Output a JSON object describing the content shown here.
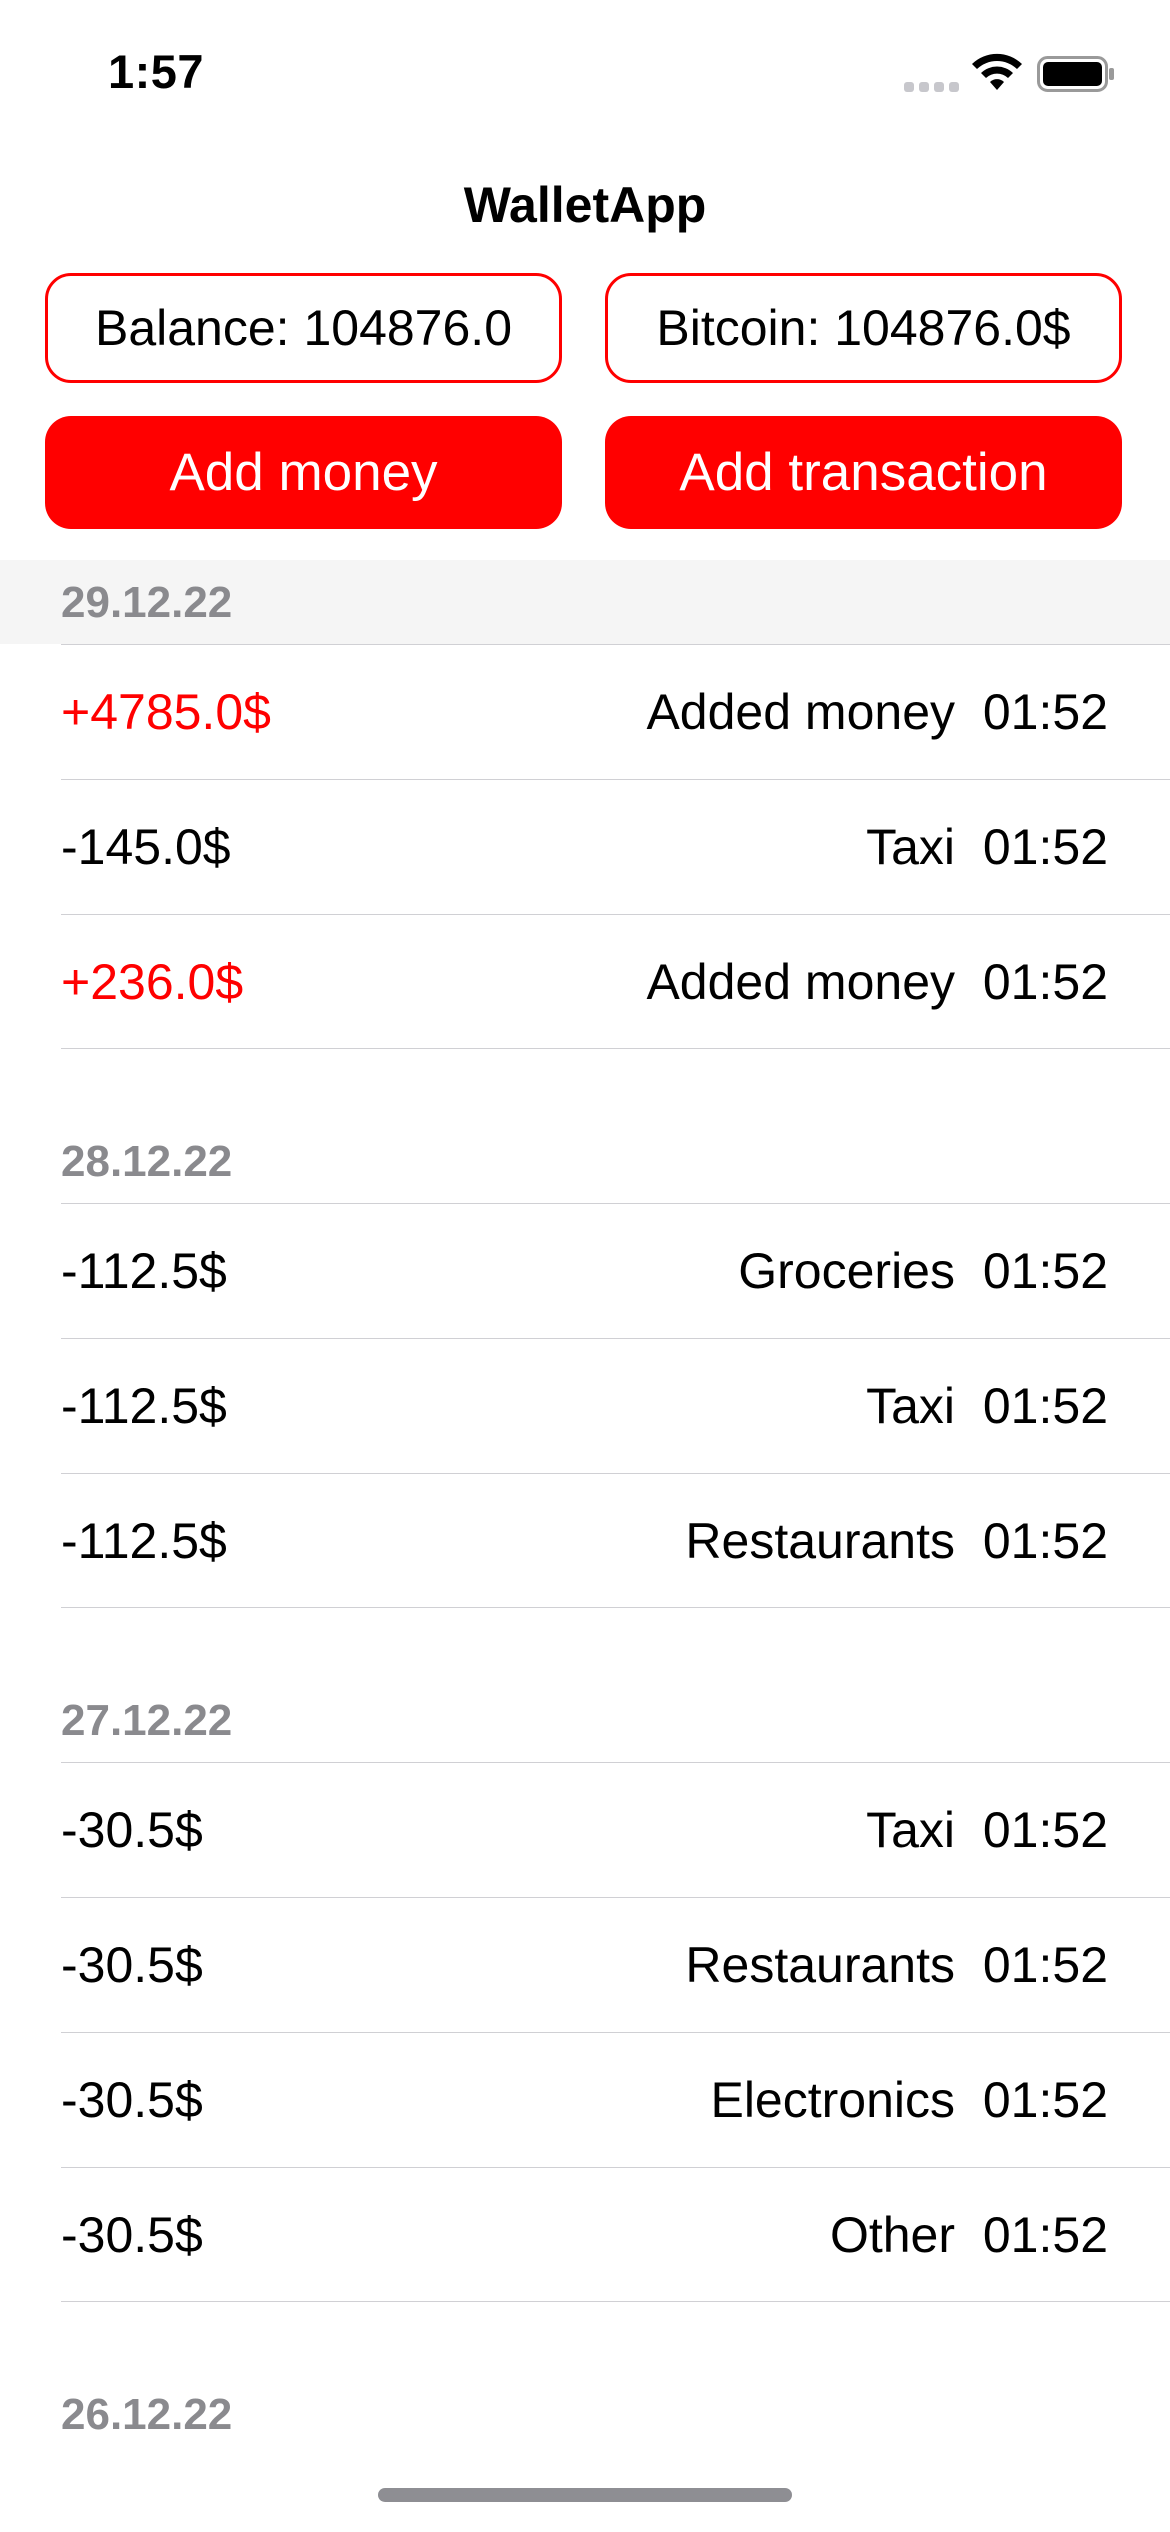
{
  "status_bar": {
    "time": "1:57"
  },
  "nav": {
    "title": "WalletApp"
  },
  "info": {
    "balance": "Balance: 104876.0",
    "bitcoin": "Bitcoin: 104876.0$"
  },
  "actions": {
    "add_money": "Add money",
    "add_transaction": "Add transaction"
  },
  "colors": {
    "accent": "#ff0000",
    "section_header_text": "#8a8a8e"
  },
  "sections": [
    {
      "date": "29.12.22",
      "rows": [
        {
          "amount": "+4785.0$",
          "category": "Added money",
          "time": "01:52",
          "positive": true
        },
        {
          "amount": "-145.0$",
          "category": "Taxi",
          "time": "01:52",
          "positive": false
        },
        {
          "amount": "+236.0$",
          "category": "Added money",
          "time": "01:52",
          "positive": true
        }
      ]
    },
    {
      "date": "28.12.22",
      "rows": [
        {
          "amount": "-112.5$",
          "category": "Groceries",
          "time": "01:52",
          "positive": false
        },
        {
          "amount": "-112.5$",
          "category": "Taxi",
          "time": "01:52",
          "positive": false
        },
        {
          "amount": "-112.5$",
          "category": "Restaurants",
          "time": "01:52",
          "positive": false
        }
      ]
    },
    {
      "date": "27.12.22",
      "rows": [
        {
          "amount": "-30.5$",
          "category": "Taxi",
          "time": "01:52",
          "positive": false
        },
        {
          "amount": "-30.5$",
          "category": "Restaurants",
          "time": "01:52",
          "positive": false
        },
        {
          "amount": "-30.5$",
          "category": "Electronics",
          "time": "01:52",
          "positive": false
        },
        {
          "amount": "-30.5$",
          "category": "Other",
          "time": "01:52",
          "positive": false
        }
      ]
    },
    {
      "date": "26.12.22",
      "rows": []
    }
  ]
}
